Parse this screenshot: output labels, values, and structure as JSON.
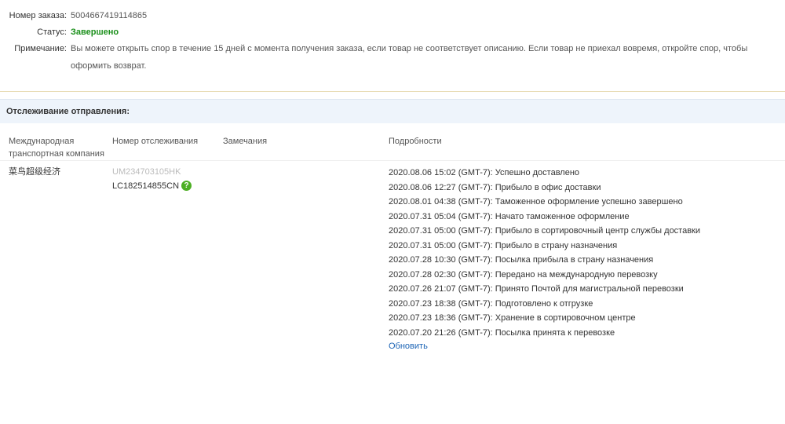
{
  "order": {
    "number_label": "Номер заказа:",
    "number_value": "5004667419114865",
    "status_label": "Статус:",
    "status_value": "Завершено",
    "note_label": "Примечание:",
    "note_value": "Вы можете открыть спор в течение 15 дней с момента получения заказа, если товар не соответствует описанию. Если товар не приехал вовремя, откройте спор, чтобы оформить возврат."
  },
  "tracking": {
    "title": "Отслеживание отправления:",
    "columns": {
      "carrier": "Международная транспортная компания",
      "number": "Номер отслеживания",
      "remarks": "Замечания",
      "details": "Подробности"
    },
    "carrier_name": "菜鸟超级经济",
    "old_number": "UM234703105HK",
    "new_number": "LC182514855CN",
    "help_icon": "question-icon",
    "events": [
      "2020.08.06 15:02 (GMT-7): Успешно доставлено",
      "2020.08.06 12:27 (GMT-7): Прибыло в офис доставки",
      "2020.08.01 04:38 (GMT-7): Таможенное оформление успешно завершено",
      "2020.07.31 05:04 (GMT-7): Начато таможенное оформление",
      "2020.07.31 05:00 (GMT-7): Прибыло в сортировочный центр службы доставки",
      "2020.07.31 05:00 (GMT-7): Прибыло в страну назначения",
      "2020.07.28 10:30 (GMT-7): Посылка прибыла в страну назначения",
      "2020.07.28 02:30 (GMT-7): Передано на международную перевозку",
      "2020.07.26 21:07 (GMT-7): Принято Почтой для магистральной перевозки",
      "2020.07.23 18:38 (GMT-7): Подготовлено к отгрузке",
      "2020.07.23 18:36 (GMT-7): Хранение в сортировочном центре",
      "2020.07.20 21:26 (GMT-7): Посылка принята к перевозке"
    ],
    "refresh_label": "Обновить"
  },
  "colors": {
    "status_green": "#1a8f1a",
    "link_blue": "#1c64b5",
    "header_bg": "#eef4fb",
    "help_icon_green": "#4caf23"
  }
}
